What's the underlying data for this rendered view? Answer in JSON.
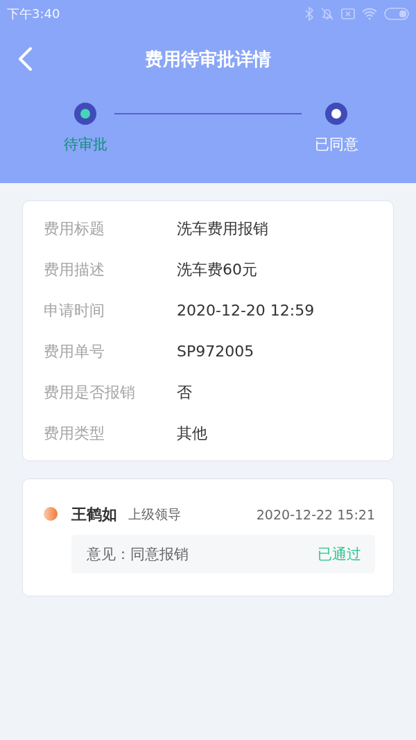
{
  "status_bar": {
    "time": "下午3:40"
  },
  "nav": {
    "title": "费用待审批详情"
  },
  "steps": [
    {
      "label": "待审批",
      "selected": true
    },
    {
      "label": "已同意",
      "selected": false
    }
  ],
  "details": [
    {
      "label": "费用标题",
      "value": "洗车费用报销"
    },
    {
      "label": "费用描述",
      "value": "洗车费60元"
    },
    {
      "label": "申请时间",
      "value": "2020-12-20 12:59"
    },
    {
      "label": "费用单号",
      "value": "SP972005"
    },
    {
      "label": "费用是否报销",
      "value": "否"
    },
    {
      "label": "费用类型",
      "value": "其他"
    }
  ],
  "approvals": [
    {
      "name": "王鹤如",
      "role": "上级领导",
      "time": "2020-12-22 15:21",
      "comment": "意见：同意报销",
      "result": "已通过"
    }
  ]
}
